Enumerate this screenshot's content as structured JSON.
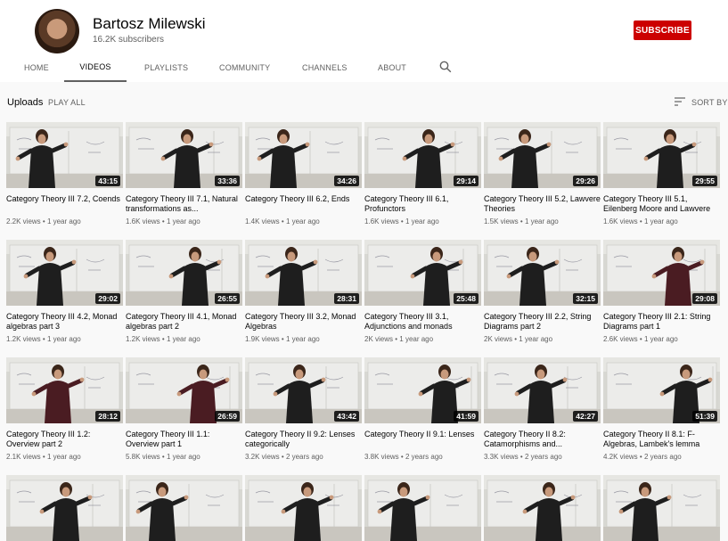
{
  "channel": {
    "name": "Bartosz Milewski",
    "subscribers": "16.2K subscribers",
    "subscribe_label": "SUBSCRIBE"
  },
  "tabs": [
    {
      "label": "HOME"
    },
    {
      "label": "VIDEOS"
    },
    {
      "label": "PLAYLISTS"
    },
    {
      "label": "COMMUNITY"
    },
    {
      "label": "CHANNELS"
    },
    {
      "label": "ABOUT"
    }
  ],
  "active_tab": "VIDEOS",
  "uploads": {
    "title": "Uploads",
    "play_all": "PLAY ALL",
    "sort_label": "SORT BY"
  },
  "videos": [
    {
      "title": "Category Theory III 7.2, Coends",
      "views": "2.2K views",
      "age": "1 year ago",
      "duration": "43:15"
    },
    {
      "title": "Category Theory III 7.1, Natural transformations as...",
      "views": "1.6K views",
      "age": "1 year ago",
      "duration": "33:36"
    },
    {
      "title": "Category Theory III 6.2, Ends",
      "views": "1.4K views",
      "age": "1 year ago",
      "duration": "34:26"
    },
    {
      "title": "Category Theory III 6.1, Profunctors",
      "views": "1.6K views",
      "age": "1 year ago",
      "duration": "29:14"
    },
    {
      "title": "Category Theory III 5.2, Lawvere Theories",
      "views": "1.5K views",
      "age": "1 year ago",
      "duration": "29:26"
    },
    {
      "title": "Category Theory III 5.1, Eilenberg Moore and Lawvere",
      "views": "1.6K views",
      "age": "1 year ago",
      "duration": "29:55"
    },
    {
      "title": "Category Theory III 4.2, Monad algebras part 3",
      "views": "1.2K views",
      "age": "1 year ago",
      "duration": "29:02"
    },
    {
      "title": "Category Theory III 4.1, Monad algebras part 2",
      "views": "1.2K views",
      "age": "1 year ago",
      "duration": "26:55"
    },
    {
      "title": "Category Theory III 3.2, Monad Algebras",
      "views": "1.9K views",
      "age": "1 year ago",
      "duration": "28:31"
    },
    {
      "title": "Category Theory III 3.1, Adjunctions and monads",
      "views": "2K views",
      "age": "1 year ago",
      "duration": "25:48"
    },
    {
      "title": "Category Theory III 2.2, String Diagrams part 2",
      "views": "2K views",
      "age": "1 year ago",
      "duration": "32:15"
    },
    {
      "title": "Category Theory III 2.1: String Diagrams part 1",
      "views": "2.6K views",
      "age": "1 year ago",
      "duration": "29:08"
    },
    {
      "title": "Category Theory III 1.2: Overview part 2",
      "views": "2.1K views",
      "age": "1 year ago",
      "duration": "28:12"
    },
    {
      "title": "Category Theory III 1.1: Overview part 1",
      "views": "5.8K views",
      "age": "1 year ago",
      "duration": "26:59"
    },
    {
      "title": "Category Theory II 9.2: Lenses categorically",
      "views": "3.2K views",
      "age": "2 years ago",
      "duration": "43:42"
    },
    {
      "title": "Category Theory II 9.1: Lenses",
      "views": "3.8K views",
      "age": "2 years ago",
      "duration": "41:59"
    },
    {
      "title": "Category Theory II 8.2: Catamorphisms and...",
      "views": "3.3K views",
      "age": "2 years ago",
      "duration": "42:27"
    },
    {
      "title": "Category Theory II 8.1: F-Algebras, Lambek's lemma",
      "views": "4.2K views",
      "age": "2 years ago",
      "duration": "51:39"
    }
  ],
  "colors": {
    "subscribe": "#cc0000",
    "background": "#f9f9f9",
    "shirt_black": "#1e1e1e",
    "shirt_maroon": "#4a1c22"
  },
  "icons": {
    "search": "search-icon",
    "sort": "sort-icon"
  }
}
